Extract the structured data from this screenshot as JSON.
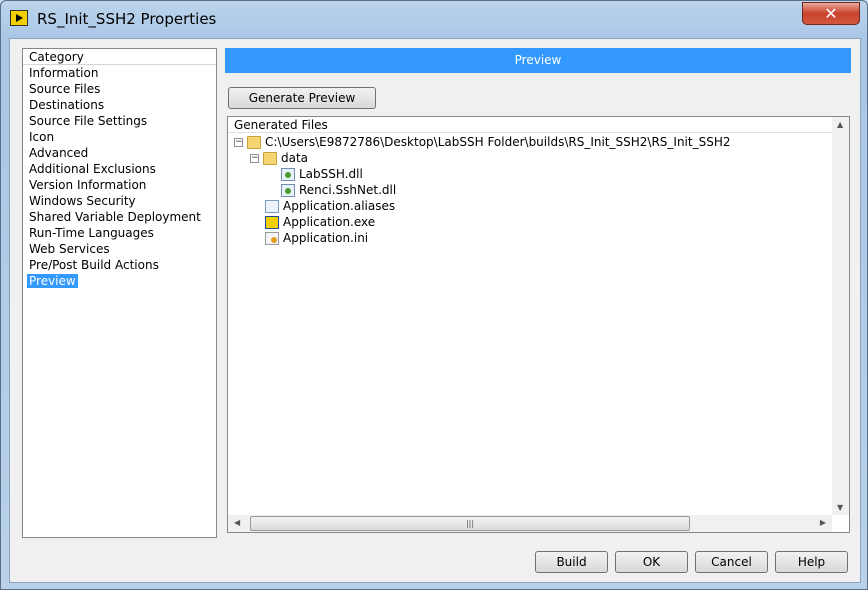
{
  "window": {
    "title": "RS_Init_SSH2 Properties",
    "close_label": "✕"
  },
  "category": {
    "header": "Category",
    "items": [
      "Information",
      "Source Files",
      "Destinations",
      "Source File Settings",
      "Icon",
      "Advanced",
      "Additional Exclusions",
      "Version Information",
      "Windows Security",
      "Shared Variable Deployment",
      "Run-Time Languages",
      "Web Services",
      "Pre/Post Build Actions",
      "Preview"
    ],
    "selected": "Preview"
  },
  "preview": {
    "header": "Preview",
    "generate_label": "Generate Preview",
    "files_header": "Generated Files",
    "tree": {
      "root": "C:\\Users\\E9872786\\Desktop\\LabSSH Folder\\builds\\RS_Init_SSH2\\RS_Init_SSH2",
      "data_folder": "data",
      "data_files": [
        "LabSSH.dll",
        "Renci.SshNet.dll"
      ],
      "files": [
        "Application.aliases",
        "Application.exe",
        "Application.ini"
      ]
    }
  },
  "buttons": {
    "build": "Build",
    "ok": "OK",
    "cancel": "Cancel",
    "help": "Help"
  },
  "colors": {
    "accent": "#3399ff"
  }
}
